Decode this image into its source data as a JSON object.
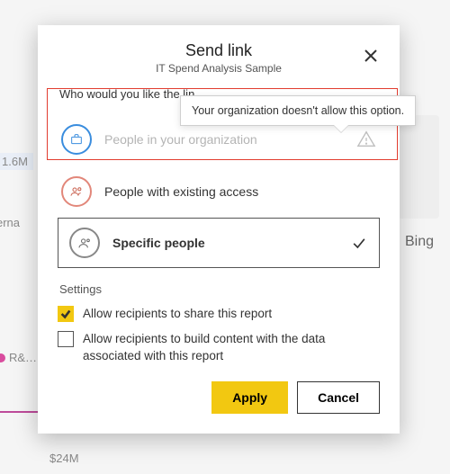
{
  "bg": {
    "val1": "1.6M",
    "val2": "erna",
    "val3": "R&…",
    "val4": "$24M",
    "bing": "Bing"
  },
  "dialog": {
    "title": "Send link",
    "subtitle": "IT Spend Analysis Sample",
    "prompt_visible": "Who would you like the lin",
    "options": {
      "org": "People in your organization",
      "existing": "People with existing access",
      "specific": "Specific people"
    },
    "settings_label": "Settings",
    "checkboxes": {
      "share": {
        "label": "Allow recipients to share this report",
        "checked": true
      },
      "build": {
        "label": "Allow recipients to build content with the data associated with this report",
        "checked": false
      }
    },
    "buttons": {
      "apply": "Apply",
      "cancel": "Cancel"
    }
  },
  "tooltip": "Your organization doesn't allow this option."
}
